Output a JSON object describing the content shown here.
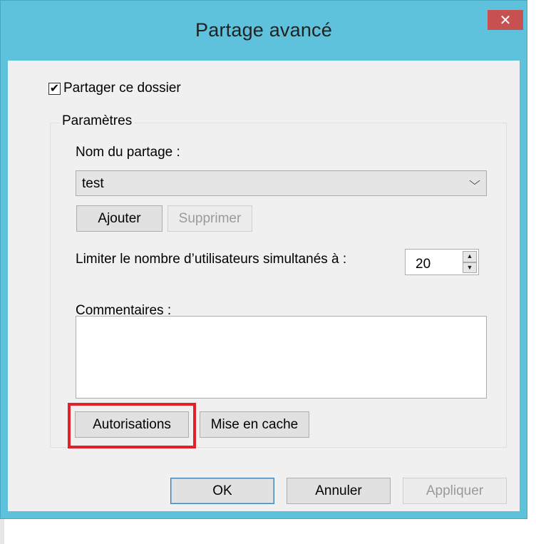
{
  "window": {
    "title": "Partage avancé",
    "close_symbol": "✕"
  },
  "share_checkbox": {
    "label": "Partager ce dossier",
    "checked": true,
    "check_symbol": "✔"
  },
  "settings_group": {
    "legend": "Paramètres",
    "share_name_label": "Nom du partage :",
    "share_name_value": "test",
    "dropdown_arrow": "⌵",
    "add_button": "Ajouter",
    "remove_button": "Supprimer",
    "user_limit_label": "Limiter le nombre d’utilisateurs simultanés à :",
    "user_limit_value": "20",
    "spin_up": "▲",
    "spin_down": "▼",
    "comments_label": "Commentaires :",
    "comments_value": "",
    "permissions_button": "Autorisations",
    "caching_button": "Mise en cache"
  },
  "footer": {
    "ok_button": "OK",
    "cancel_button": "Annuler",
    "apply_button": "Appliquer"
  },
  "colors": {
    "title_bar": "#5ec2dc",
    "close_button": "#c75050",
    "highlight_box": "#e0212a"
  }
}
